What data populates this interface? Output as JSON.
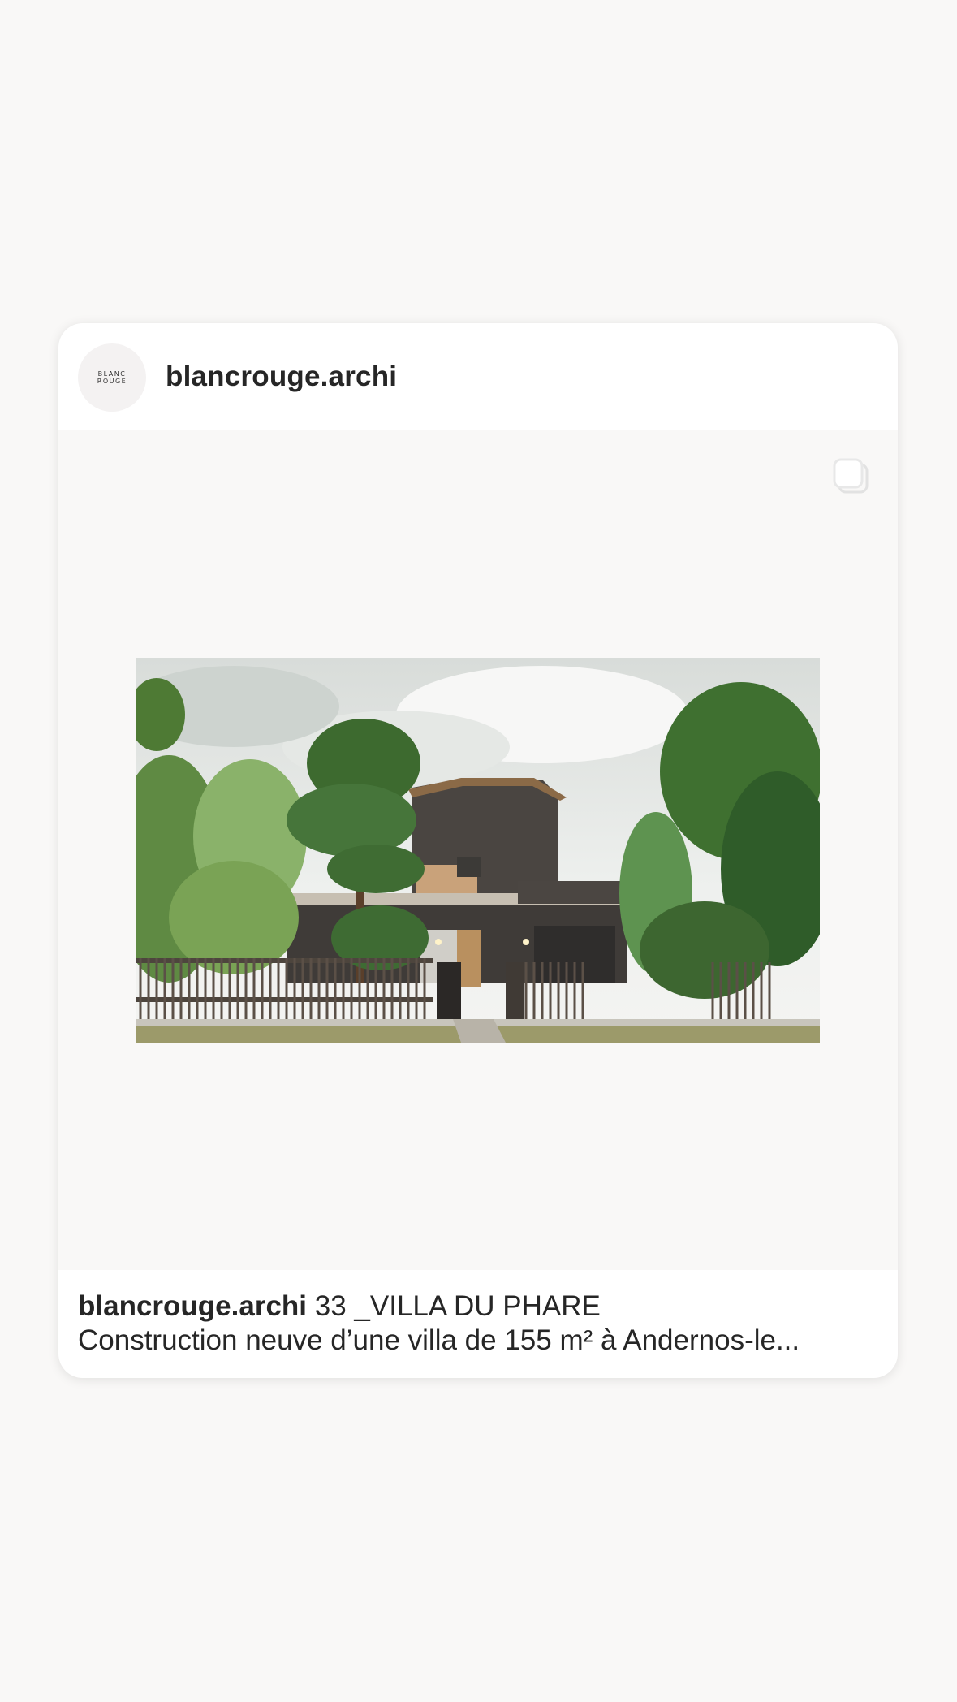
{
  "post": {
    "username": "blancrouge.archi",
    "avatar": {
      "line1": "BLANC",
      "line2": "ROUGE"
    },
    "media": {
      "type": "carousel",
      "carousel_icon": "carousel-icon",
      "image_description_icon": "villa-rendering-image"
    },
    "caption": {
      "username": "blancrouge.archi",
      "title": "33 _VILLA DU PHARE",
      "text": "Construction neuve d’une villa de 155 m² à Andernos-le..."
    }
  },
  "colors": {
    "background": "#f9f8f7",
    "card": "#ffffff",
    "text": "#262626"
  }
}
